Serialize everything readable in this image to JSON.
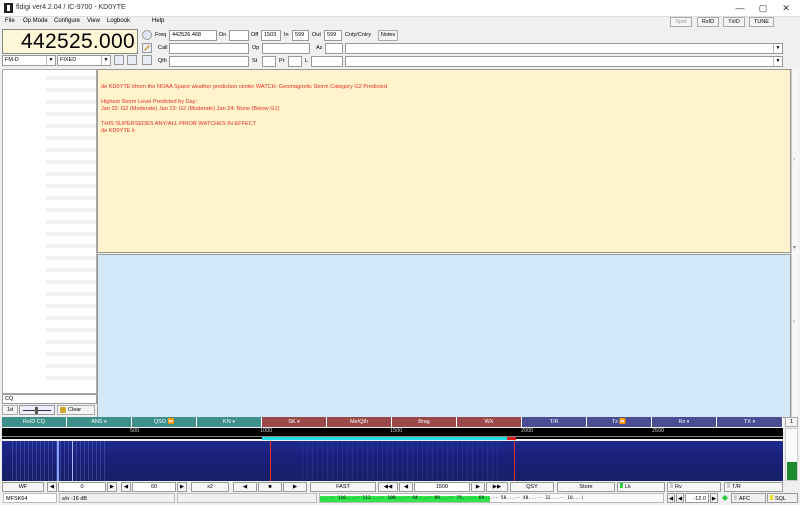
{
  "window": {
    "title": "fldigi ver4.2.04 / IC-9700 - KD0YTE",
    "min": "—",
    "max": "▢",
    "close": "✕"
  },
  "menu": [
    "File",
    "Op Mode",
    "Configure",
    "View",
    "Logbook",
    "Help"
  ],
  "top_buttons": [
    "Spot",
    "RxID",
    "TxID",
    "TUNE"
  ],
  "rig": {
    "frequency_display": "442525.000",
    "mode": "FM-D",
    "bandwidth": "FIXED"
  },
  "log": {
    "freq_label": "Freq",
    "freq_value": "442526.468",
    "on_label": "On",
    "off_label": "Off",
    "off_value": "1503",
    "in_label": "In",
    "in_value": "599",
    "out_label": "Out",
    "out_value": "599",
    "cnty_label": "Cnty/Cntry",
    "notes_label": "Notes",
    "call_label": "Call",
    "op_label": "Op",
    "az_label": "Az",
    "qth_label": "Qth",
    "st_label": "St",
    "pr_label": "Pr",
    "l_label": "L"
  },
  "rx_text": [
    "de KD0YTE kfrom the NOAA Space weather prediction center WATCH: Geomagnetic Storm Category G2 Predicted",
    "Highest Storm Level Predicted by Day:",
    "Jan 22:  G2 (Moderate)   Jan 23:  G2 (Moderate)   Jan 24:  None (Below G1)",
    "THIS SUPERSEDES ANY/ALL PRIOR WATCHES IN EFFECT",
    "de KD0YTE k"
  ],
  "left_panel": {
    "cq_label": "CQ",
    "speed_label": "1d",
    "clear_label": "Clear"
  },
  "macros": [
    {
      "label": "RxID CQ",
      "color": "#3f8f8a"
    },
    {
      "label": "ANS ⏸",
      "color": "#3f8f8a"
    },
    {
      "label": "QSO ⏩",
      "color": "#3f8f8a"
    },
    {
      "label": "KN ⏸",
      "color": "#3f8f8a"
    },
    {
      "label": "SK ⏸",
      "color": "#9a4a4a"
    },
    {
      "label": "Me/Qth",
      "color": "#9a4a4a"
    },
    {
      "label": "Brag",
      "color": "#9a4a4a"
    },
    {
      "label": "WX",
      "color": "#9a4a4a"
    },
    {
      "label": "T/R",
      "color": "#4a4d92"
    },
    {
      "label": "Tx ⏩",
      "color": "#4a4d92"
    },
    {
      "label": "Rx ⏸",
      "color": "#4a4d92"
    },
    {
      "label": "TX ⏸",
      "color": "#4a4d92"
    }
  ],
  "macro_set": "1",
  "ruler_ticks": [
    "500",
    "1000",
    "1500",
    "2000",
    "2500"
  ],
  "wf_controls": {
    "wf": "WF",
    "ref": "0",
    "range": "60",
    "zoom": "x2",
    "speed": "FAST",
    "carrier": "1500",
    "qsy": "QSY",
    "store": "Store",
    "lk": "Lk",
    "rv": "Rv",
    "tr": "T/R"
  },
  "status": {
    "mode": "MFSK64",
    "sn": "s/n -16 dB",
    "scope_text": "...-- 116...-- 112...-- 108...-- 94...-- 89...-- 75...-- 69...-- 58...-- 48...-- 32...-- 10...)",
    "level": "-12.0",
    "afc": "AFC",
    "sql": "SQL"
  }
}
